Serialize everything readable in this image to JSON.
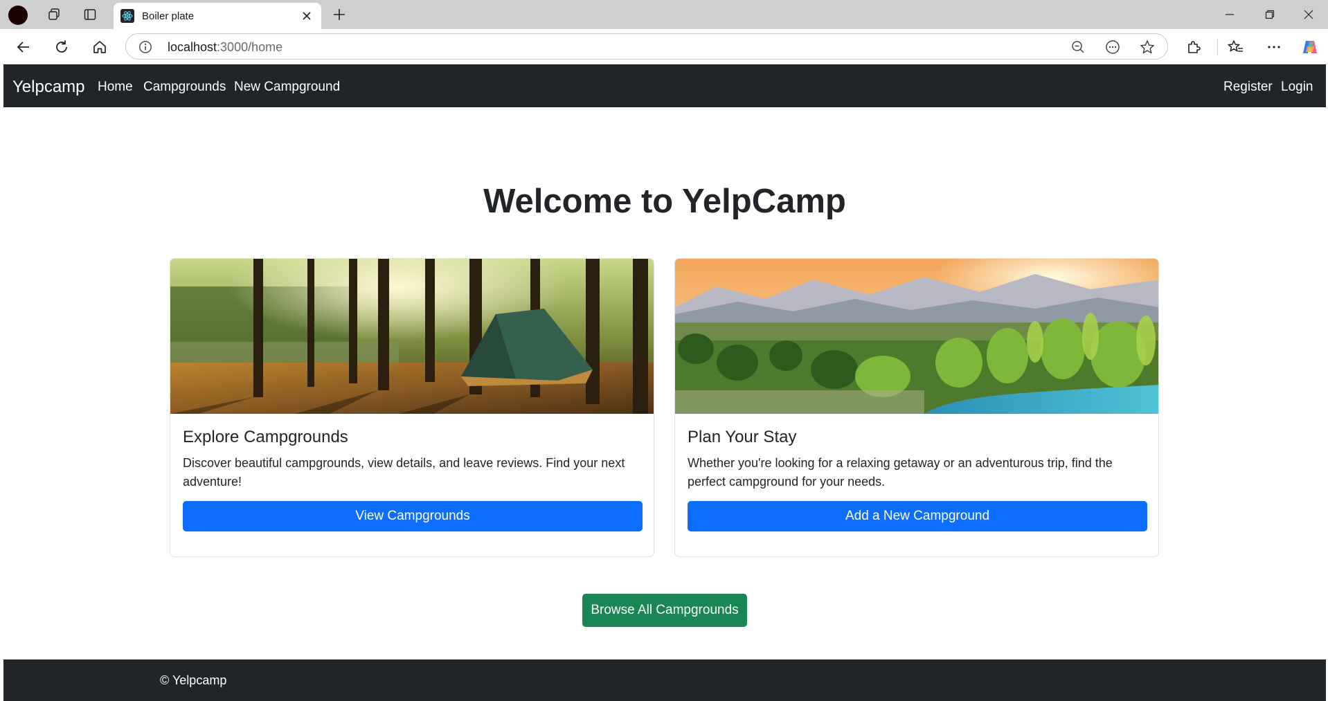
{
  "browser": {
    "tab_title": "Boiler plate",
    "url_host": "localhost",
    "url_path": ":3000/home"
  },
  "navbar": {
    "brand": "Yelpcamp",
    "links": [
      "Home",
      "Campgrounds",
      "New Campground"
    ],
    "right_links": [
      "Register",
      "Login"
    ]
  },
  "main": {
    "title": "Welcome to YelpCamp",
    "cards": [
      {
        "title": "Explore Campgrounds",
        "text": "Discover beautiful campgrounds, view details, and leave reviews. Find your next adventure!",
        "button": "View Campgrounds",
        "image": "forest-tent-sunset-photo"
      },
      {
        "title": "Plan Your Stay",
        "text": "Whether you're looking for a relaxing getaway or an adventurous trip, find the perfect campground for your needs.",
        "button": "Add a New Campground",
        "image": "mountain-river-sunset-photo"
      }
    ],
    "browse_button": "Browse All Campgrounds"
  },
  "footer": {
    "text": "© Yelpcamp"
  },
  "colors": {
    "navbar_bg": "#212529",
    "primary": "#0d6efd",
    "success": "#198754"
  }
}
